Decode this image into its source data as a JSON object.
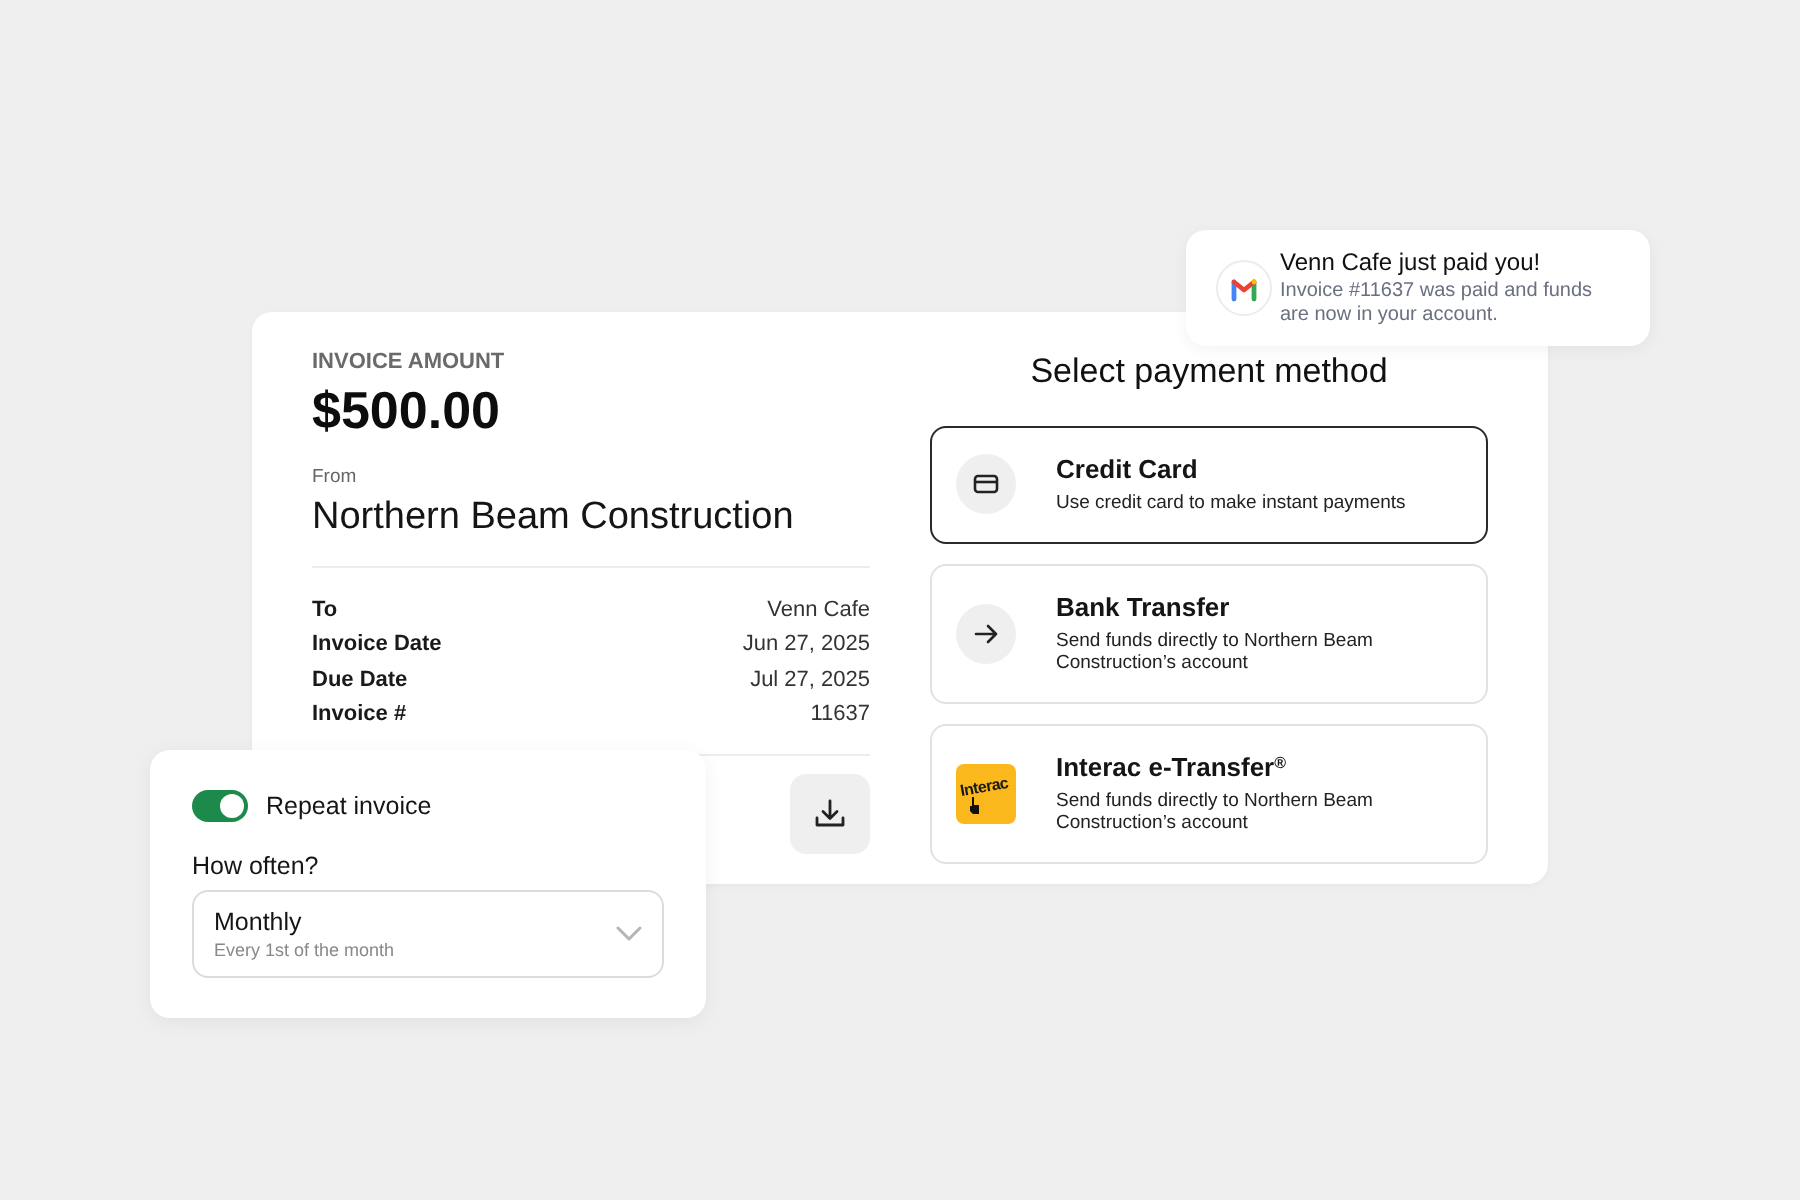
{
  "notification": {
    "title": "Venn Cafe just paid you!",
    "message": "Invoice #11637 was paid and funds are now in your account."
  },
  "invoice": {
    "amount_label": "INVOICE AMOUNT",
    "amount": "$500.00",
    "from_label": "From",
    "from": "Northern Beam Construction",
    "details": [
      {
        "label": "To",
        "value": "Venn Cafe"
      },
      {
        "label": "Invoice Date",
        "value": "Jun 27, 2025"
      },
      {
        "label": "Due Date",
        "value": "Jul 27, 2025"
      },
      {
        "label": "Invoice #",
        "value": "11637"
      }
    ]
  },
  "payment": {
    "title": "Select payment method",
    "methods": [
      {
        "kind": "card",
        "title": "Credit Card",
        "description": "Use credit card to make instant payments",
        "selected": true
      },
      {
        "kind": "bank",
        "title": "Bank Transfer",
        "description": "Send funds directly to Northern Beam Construction’s account",
        "selected": false
      },
      {
        "kind": "interac",
        "logo_text": "Interac",
        "title": "Interac e-Transfer$^{®}$",
        "description": "Send funds directly to Northern Beam Construction’s account",
        "selected": false
      }
    ]
  },
  "repeat": {
    "label": "Repeat invoice",
    "on": true,
    "question": "How often?",
    "frequency": {
      "value": "Monthly",
      "hint": "Every 1st of the month"
    }
  }
}
